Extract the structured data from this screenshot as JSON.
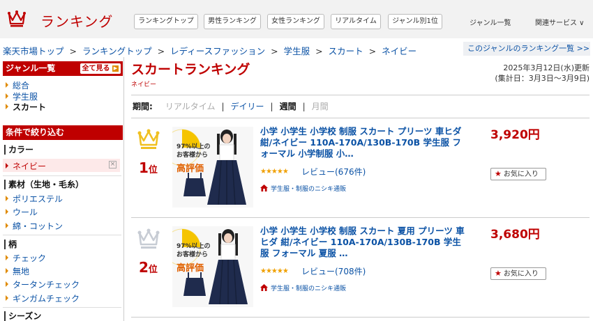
{
  "header": {
    "logo_text": "ランキング",
    "nav_buttons": [
      "ランキングトップ",
      "男性ランキング",
      "女性ランキング",
      "リアルタイム",
      "ジャンル別1位"
    ],
    "genre_link": "ジャンル一覧",
    "related_link": "関連サービス ∨",
    "accent_color": "#bf0000"
  },
  "breadcrumb": {
    "items": [
      "楽天市場トップ",
      "ランキングトップ",
      "レディースファッション",
      "学生服",
      "スカート",
      "ネイビー"
    ],
    "separator": ">"
  },
  "genre_ranking_link": "このジャンルのランキング一覧 >>",
  "sidebar": {
    "genre_header": "ジャンル一覧",
    "see_all": "全て見る",
    "genres": [
      "総合",
      "学生服",
      "スカート"
    ],
    "filter_header": "条件で絞り込む",
    "color_label": "カラー",
    "selected_color": "ネイビー",
    "material_label": "素材（生地・毛糸）",
    "materials": [
      "ポリエステル",
      "ウール",
      "綿・コットン"
    ],
    "pattern_label": "柄",
    "patterns": [
      "チェック",
      "無地",
      "タータンチェック",
      "ギンガムチェック"
    ],
    "season_label": "シーズン"
  },
  "main": {
    "title": "スカートランキング",
    "subtitle": "ネイビー",
    "updated": "2025年3月12日(水)更新",
    "period_range": "(集計日：3月3日〜3月9日)",
    "period_label": "期間:",
    "periods": [
      "リアルタイム",
      "デイリー",
      "週間",
      "月間"
    ],
    "active_period": "週間"
  },
  "items": [
    {
      "rank": "1",
      "rank_suffix": "位",
      "crown_color": "#f0c020",
      "title": "小学 小学生 小学校 制服 スカート プリーツ 車ヒダ 紺/ネイビー 110A-170A/130B-170B 学生服 フォーマル 小学制服 小…",
      "stars": "★★★★★",
      "review": "レビュー(676件)",
      "shop": "学生服・制服のニシキ通販",
      "price": "3,920円",
      "favorite": "お気に入り",
      "badge_line1": "97%以上の",
      "badge_line2": "お客様から",
      "badge_line3": "高評価"
    },
    {
      "rank": "2",
      "rank_suffix": "位",
      "crown_color": "#c7ccd4",
      "title": "小学 小学生 小学校 制服 スカート 夏用 プリーツ 車ヒダ 紺/ネイビー 110A-170A/130B-170B 学生服 フォーマル 夏服 …",
      "stars": "★★★★★",
      "review": "レビュー(708件)",
      "shop": "学生服・制服のニシキ通販",
      "price": "3,680円",
      "favorite": "お気に入り",
      "badge_line1": "97%以上の",
      "badge_line2": "お客様から",
      "badge_line3": "高評価"
    }
  ]
}
